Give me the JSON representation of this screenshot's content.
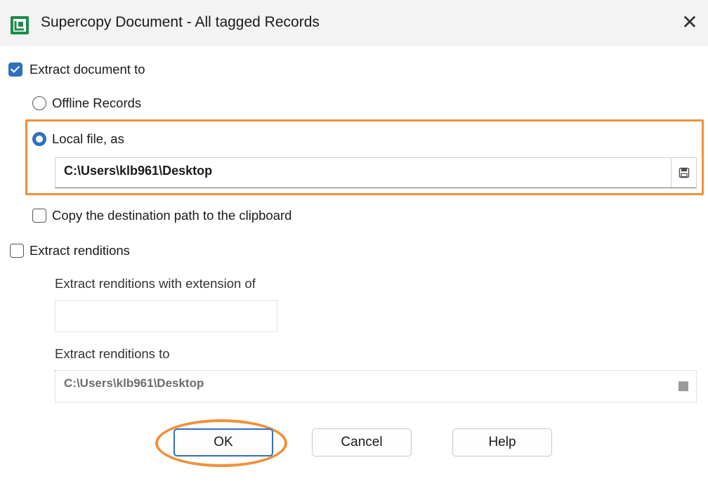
{
  "window": {
    "title": "Supercopy Document - All tagged Records",
    "close_glyph": "✕",
    "icon": "app-document-icon"
  },
  "extract_document": {
    "label": "Extract document to",
    "checked": true
  },
  "destination": {
    "offline_records": {
      "label": "Offline Records",
      "selected": false
    },
    "local_file": {
      "label": "Local file, as",
      "selected": true
    },
    "path_value": "C:\\Users\\klb961\\Desktop",
    "browse_icon": "save-icon"
  },
  "copy_destination": {
    "label": "Copy the destination path to the clipboard",
    "checked": false
  },
  "extract_renditions": {
    "label": "Extract renditions",
    "checked": false,
    "extension_label": "Extract renditions with extension of",
    "extension_value": "",
    "to_label": "Extract renditions to",
    "to_value": "C:\\Users\\klb961\\Desktop"
  },
  "buttons": {
    "ok": "OK",
    "cancel": "Cancel",
    "help": "Help"
  },
  "colors": {
    "accent": "#2f6fbf",
    "highlight": "#f0913a"
  }
}
